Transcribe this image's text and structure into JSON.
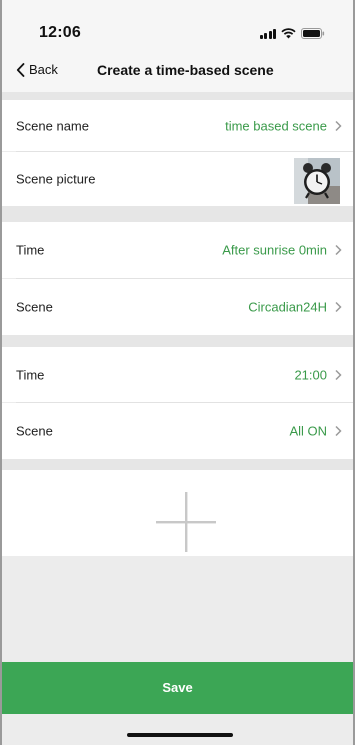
{
  "status_bar": {
    "time": "12:06"
  },
  "nav": {
    "back_label": "Back",
    "title": "Create a time-based scene"
  },
  "rows": {
    "scene_name": {
      "label": "Scene name",
      "value": "time based scene"
    },
    "scene_picture": {
      "label": "Scene picture"
    },
    "time_1": {
      "label": "Time",
      "value": "After sunrise 0min"
    },
    "scene_1": {
      "label": "Scene",
      "value": "Circadian24H"
    },
    "time_2": {
      "label": "Time",
      "value": "21:00"
    },
    "scene_2": {
      "label": "Scene",
      "value": "All ON"
    }
  },
  "save_label": "Save",
  "colors": {
    "accent": "#3ca655",
    "value_text": "#3a9a4a",
    "background": "#ececec"
  },
  "icons": [
    "signal-icon",
    "wifi-icon",
    "battery-icon",
    "back-chevron-icon",
    "chevron-right-icon",
    "add-icon"
  ]
}
